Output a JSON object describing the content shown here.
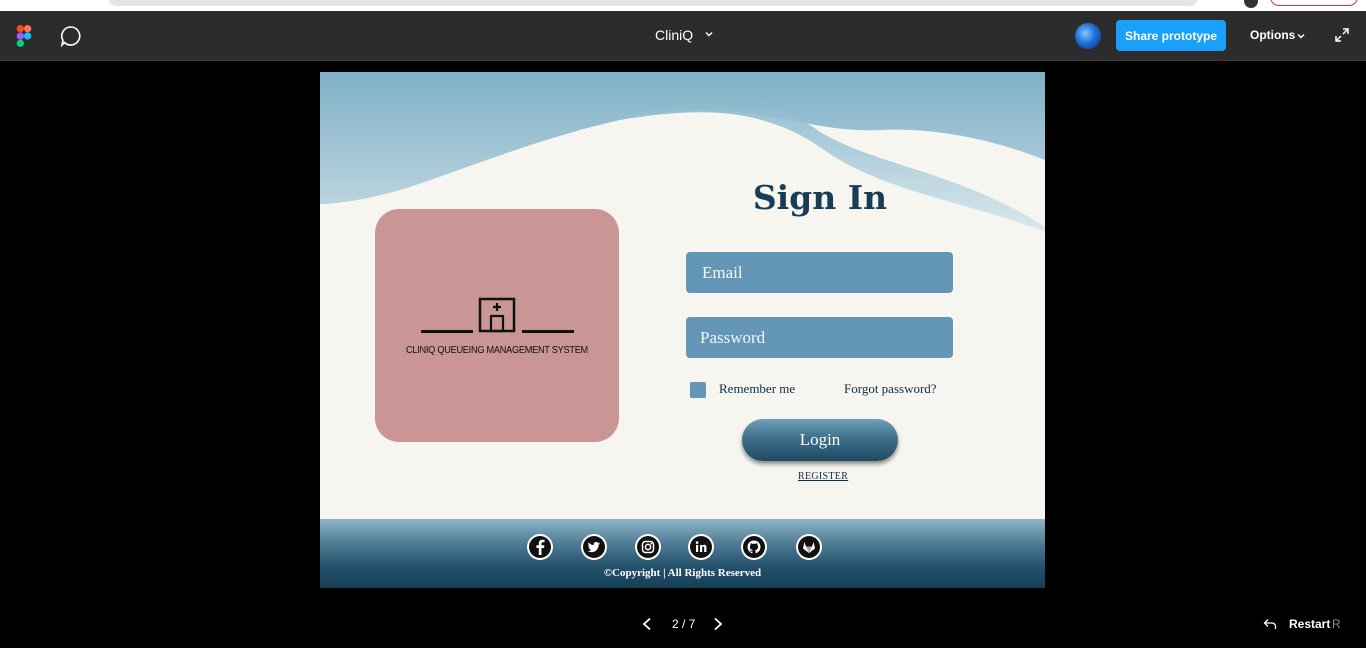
{
  "toolbar": {
    "title": "CliniQ",
    "share_label": "Share prototype",
    "options_label": "Options"
  },
  "login": {
    "logo_text": "CLINIQ QUEUEING MANAGEMENT SYSTEM",
    "title": "Sign In",
    "email_placeholder": "Email",
    "password_placeholder": "Password",
    "remember_label": "Remember me",
    "forgot_label": "Forgot password?",
    "login_label": "Login",
    "register_label": "REGISTER",
    "footer_copyright": "©Copyright | All Rights Reserved",
    "social_icons": [
      "facebook-icon",
      "twitter-icon",
      "instagram-icon",
      "linkedin-icon",
      "github-icon",
      "gitlab-icon"
    ]
  },
  "nav": {
    "page_indicator": "2 / 7",
    "restart_label": "Restart",
    "restart_shortcut": "R"
  },
  "colors": {
    "toolbar_bg": "#2c2c2c",
    "share_button": "#18a0fb",
    "field_bg": "#6497b6",
    "logo_card": "#c99595",
    "title": "#1a3d57",
    "frame_bg": "#f6f5f0"
  }
}
